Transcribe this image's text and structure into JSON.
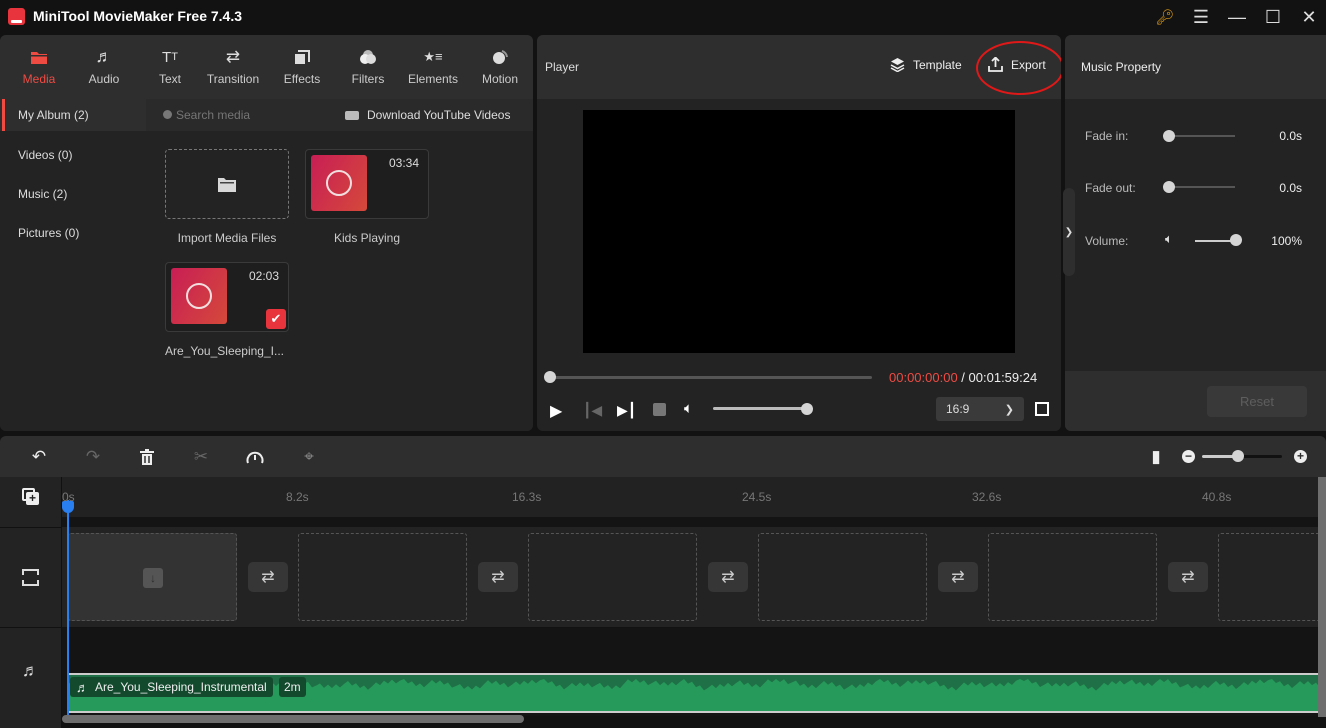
{
  "app": {
    "title": "MiniTool MovieMaker Free 7.4.3",
    "window_controls": [
      "key-icon",
      "menu-icon",
      "minimize-icon",
      "maximize-icon",
      "close-icon"
    ]
  },
  "toolbar": {
    "tabs": [
      {
        "label": "Media",
        "icon": "folder-icon",
        "active": true
      },
      {
        "label": "Audio",
        "icon": "music-icon",
        "active": false
      },
      {
        "label": "Text",
        "icon": "text-icon",
        "active": false
      },
      {
        "label": "Transition",
        "icon": "swap-icon",
        "active": false
      },
      {
        "label": "Effects",
        "icon": "effects-icon",
        "active": false
      },
      {
        "label": "Filters",
        "icon": "filters-icon",
        "active": false
      },
      {
        "label": "Elements",
        "icon": "elements-icon",
        "active": false
      },
      {
        "label": "Motion",
        "icon": "motion-icon",
        "active": false
      }
    ]
  },
  "sidebar": {
    "items": [
      {
        "label": "My Album (2)",
        "selected": true
      },
      {
        "label": "Videos (0)",
        "selected": false
      },
      {
        "label": "Music (2)",
        "selected": false
      },
      {
        "label": "Pictures (0)",
        "selected": false
      }
    ]
  },
  "media": {
    "search_placeholder": "Search media",
    "download_label": "Download YouTube Videos",
    "import_label": "Import Media Files",
    "items": [
      {
        "name": "Kids Playing",
        "duration": "03:34",
        "selected": false
      },
      {
        "name": "Are_You_Sleeping_I...",
        "duration": "02:03",
        "selected": true
      }
    ]
  },
  "player": {
    "title": "Player",
    "template_label": "Template",
    "export_label": "Export",
    "current_time": "00:00:00:00",
    "separator": " / ",
    "total_time": "00:01:59:24",
    "progress": 0,
    "volume": 1.0,
    "aspect_ratio": "16:9"
  },
  "property": {
    "title": "Music Property",
    "fade_in_label": "Fade in:",
    "fade_in_value": "0.0s",
    "fade_out_label": "Fade out:",
    "fade_out_value": "0.0s",
    "volume_label": "Volume:",
    "volume_value": "100%",
    "reset_label": "Reset"
  },
  "timeline": {
    "ruler": [
      "0s",
      "8.2s",
      "16.3s",
      "24.5s",
      "32.6s",
      "40.8s"
    ],
    "zoom_level": 0.45,
    "audio_clip": {
      "name": "Are_You_Sleeping_Instrumental",
      "duration": "2m"
    }
  },
  "colors": {
    "accent": "#ef4b43",
    "playhead": "#2a7ff0",
    "audio_clip": "#269a5a",
    "time_current": "#ef4b43"
  }
}
